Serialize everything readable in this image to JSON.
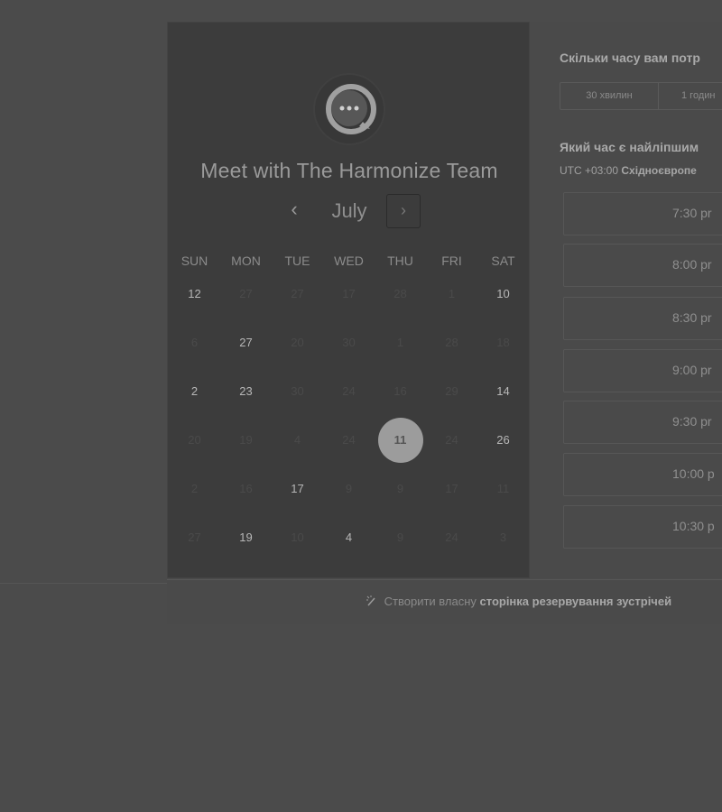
{
  "title": "Meet with The Harmonize Team",
  "calendar": {
    "month": "July",
    "prev_icon": "‹",
    "next_icon": "›",
    "weekdays": [
      "SUN",
      "MON",
      "TUE",
      "WED",
      "THU",
      "FRI",
      "SAT"
    ],
    "weeks": [
      [
        {
          "d": "12",
          "s": "active"
        },
        {
          "d": "27",
          "s": "muted"
        },
        {
          "d": "27",
          "s": "muted"
        },
        {
          "d": "17",
          "s": "muted"
        },
        {
          "d": "28",
          "s": "muted"
        },
        {
          "d": "1",
          "s": "muted"
        },
        {
          "d": "10",
          "s": "active"
        }
      ],
      [
        {
          "d": "6",
          "s": "muted"
        },
        {
          "d": "27",
          "s": "active"
        },
        {
          "d": "20",
          "s": "muted"
        },
        {
          "d": "30",
          "s": "muted"
        },
        {
          "d": "1",
          "s": "muted"
        },
        {
          "d": "28",
          "s": "muted"
        },
        {
          "d": "18",
          "s": "muted"
        }
      ],
      [
        {
          "d": "2",
          "s": "active"
        },
        {
          "d": "23",
          "s": "active"
        },
        {
          "d": "30",
          "s": "muted"
        },
        {
          "d": "24",
          "s": "muted"
        },
        {
          "d": "16",
          "s": "muted"
        },
        {
          "d": "29",
          "s": "muted"
        },
        {
          "d": "14",
          "s": "active"
        }
      ],
      [
        {
          "d": "20",
          "s": "muted"
        },
        {
          "d": "19",
          "s": "muted"
        },
        {
          "d": "4",
          "s": "muted"
        },
        {
          "d": "24",
          "s": "muted"
        },
        {
          "d": "11",
          "s": "selected"
        },
        {
          "d": "24",
          "s": "muted"
        },
        {
          "d": "26",
          "s": "active"
        }
      ],
      [
        {
          "d": "2",
          "s": "muted"
        },
        {
          "d": "16",
          "s": "muted"
        },
        {
          "d": "17",
          "s": "active"
        },
        {
          "d": "9",
          "s": "muted"
        },
        {
          "d": "9",
          "s": "muted"
        },
        {
          "d": "17",
          "s": "muted"
        },
        {
          "d": "11",
          "s": "muted"
        }
      ],
      [
        {
          "d": "27",
          "s": "muted"
        },
        {
          "d": "19",
          "s": "active"
        },
        {
          "d": "10",
          "s": "muted"
        },
        {
          "d": "4",
          "s": "active"
        },
        {
          "d": "9",
          "s": "muted"
        },
        {
          "d": "24",
          "s": "muted"
        },
        {
          "d": "3",
          "s": "muted"
        }
      ]
    ]
  },
  "duration": {
    "question": "Скільки часу вам потр",
    "options": [
      "30 хвилин",
      "1 годин"
    ]
  },
  "time": {
    "question": "Який час є найліпшим",
    "timezone_offset": "UTC +03:00",
    "timezone_name": "Східноєвропе",
    "slots": [
      "7:30 pr",
      "8:00 pr",
      "8:30 pr",
      "9:00 pr",
      "9:30 pr",
      "10:00 p",
      "10:30 p"
    ]
  },
  "footer": {
    "prefix": "Створити власну",
    "bold": "сторінка резервування зустрічей"
  },
  "colors": {
    "page_bg": "#4b4b4b",
    "panel_bg": "#3c3c3c",
    "selected_day": "#9c9c9c"
  }
}
